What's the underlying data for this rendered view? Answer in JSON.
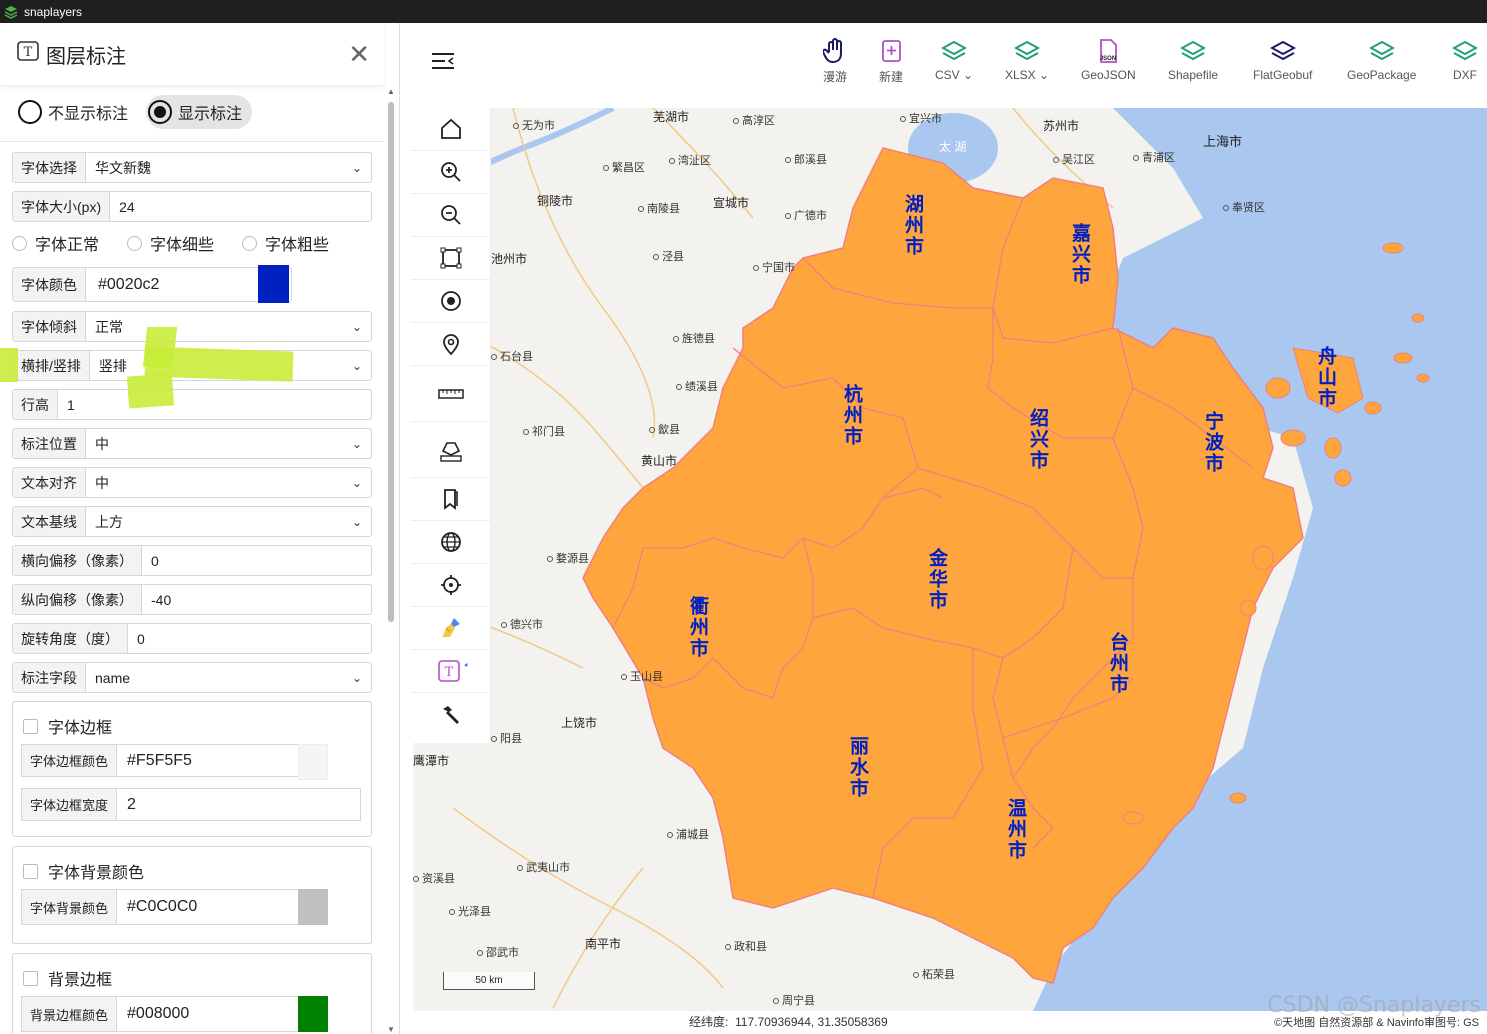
{
  "app": {
    "title": "snaplayers"
  },
  "panel": {
    "title": "图层标注",
    "mode_off": "不显示标注",
    "mode_on": "显示标注",
    "font_select_label": "字体选择",
    "font_select_value": "华文新魏",
    "font_size_label": "字体大小(px)",
    "font_size_value": "24",
    "weight_normal": "字体正常",
    "weight_thin": "字体细些",
    "weight_bold": "字体粗些",
    "font_color_label": "字体颜色",
    "font_color_value": "#0020c2",
    "italic_label": "字体倾斜",
    "italic_value": "正常",
    "orient_label": "横排/竖排",
    "orient_value": "竖排",
    "line_height_label": "行高",
    "line_height_value": "1",
    "position_label": "标注位置",
    "position_value": "中",
    "align_label": "文本对齐",
    "align_value": "中",
    "baseline_label": "文本基线",
    "baseline_value": "上方",
    "offset_x_label": "横向偏移（像素）",
    "offset_x_value": "0",
    "offset_y_label": "纵向偏移（像素）",
    "offset_y_value": "-40",
    "rotate_label": "旋转角度（度）",
    "rotate_value": "0",
    "field_label": "标注字段",
    "field_value": "name",
    "stroke_group": "字体边框",
    "stroke_color_label": "字体边框颜色",
    "stroke_color_value": "#F5F5F5",
    "stroke_width_label": "字体边框宽度",
    "stroke_width_value": "2",
    "bg_group": "字体背景颜色",
    "bg_color_label": "字体背景颜色",
    "bg_color_value": "#C0C0C0",
    "border_group": "背景边框",
    "border_color_label": "背景边框颜色",
    "border_color_value": "#008000"
  },
  "toolbar": {
    "pan": "漫游",
    "new": "新建",
    "csv": "CSV",
    "xlsx": "XLSX",
    "geojson": "GeoJSON",
    "shapefile": "Shapefile",
    "flatgeobuf": "FlatGeobuf",
    "geopackage": "GeoPackage",
    "dxf": "DXF"
  },
  "colors": {
    "accent": "#0020c2",
    "fill": "#ffa53d",
    "water": "#a9c7ef",
    "stroke_swatch": "#F5F5F5",
    "bg_swatch": "#C0C0C0",
    "border_swatch": "#008000"
  },
  "map": {
    "regions": [
      "湖州市",
      "嘉兴市",
      "舟山市",
      "杭州市",
      "绍兴市",
      "宁波市",
      "金华市",
      "衢州市",
      "台州市",
      "丽水市",
      "温州市"
    ],
    "places": [
      "芜湖市",
      "无为市",
      "高淳区",
      "宜兴市",
      "苏州市",
      "上海市",
      "繁昌区",
      "湾沚区",
      "郎溪县",
      "吴江区",
      "青浦区",
      "太 湖",
      "铜陵市",
      "南陵县",
      "宣城市",
      "广德市",
      "奉贤区",
      "池州市",
      "泾县",
      "宁国市",
      "旌德县",
      "石台县",
      "绩溪县",
      "祁门县",
      "歙县",
      "黄山市",
      "婺源县",
      "德兴市",
      "玉山县",
      "上饶市",
      "阳县",
      "鹰潭市",
      "浦城县",
      "武夷山市",
      "资溪县",
      "光泽县",
      "邵武市",
      "南平市",
      "政和县",
      "柘荣县",
      "周宁县"
    ],
    "scale": "50 km"
  },
  "status": {
    "coord_label": "经纬度:",
    "coord_value": "117.70936944, 31.35058369",
    "attribution": "©天地图 自然资源部 & Navinfo审图号: GS",
    "watermark": "CSDN @Snaplayers"
  }
}
